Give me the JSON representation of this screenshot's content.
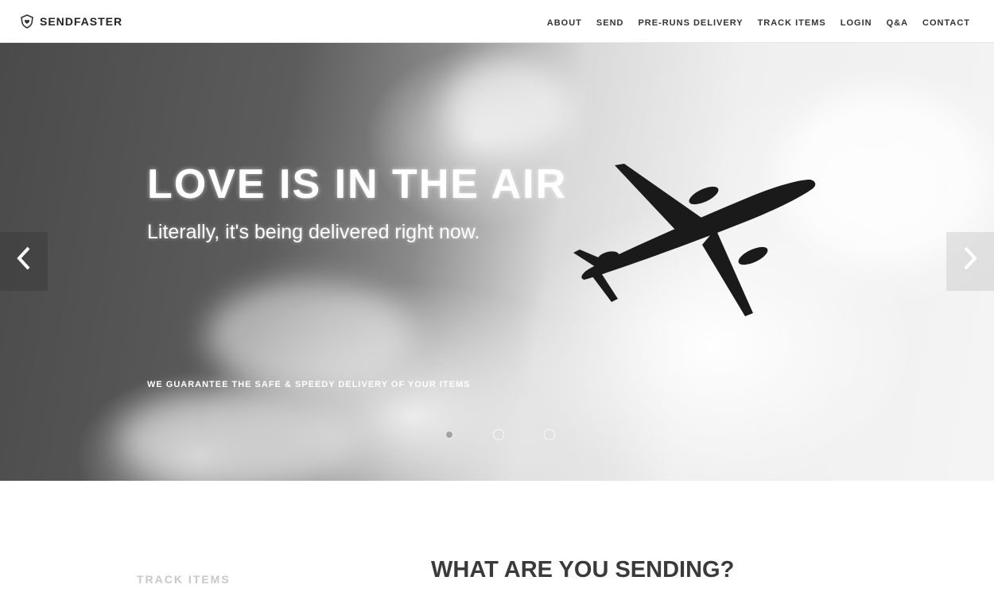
{
  "navbar": {
    "brand": "SENDFASTER",
    "links": [
      "ABOUT",
      "SEND",
      "PRE-RUNS DELIVERY",
      "TRACK ITEMS",
      "LOGIN",
      "Q&A",
      "CONTACT"
    ]
  },
  "hero": {
    "title": "LOVE IS IN THE AIR",
    "subtitle": "Literally, it's being delivered right now.",
    "tagline": "WE GUARANTEE THE SAFE & SPEEDY DELIVERY OF YOUR ITEMS",
    "slides_total": 3,
    "active_slide": 1,
    "prev_icon": "chevron-left-icon",
    "next_icon": "chevron-right-icon"
  },
  "below": {
    "track_label": "TRACK ITEMS",
    "section_heading": "WHAT ARE YOU SENDING?"
  }
}
